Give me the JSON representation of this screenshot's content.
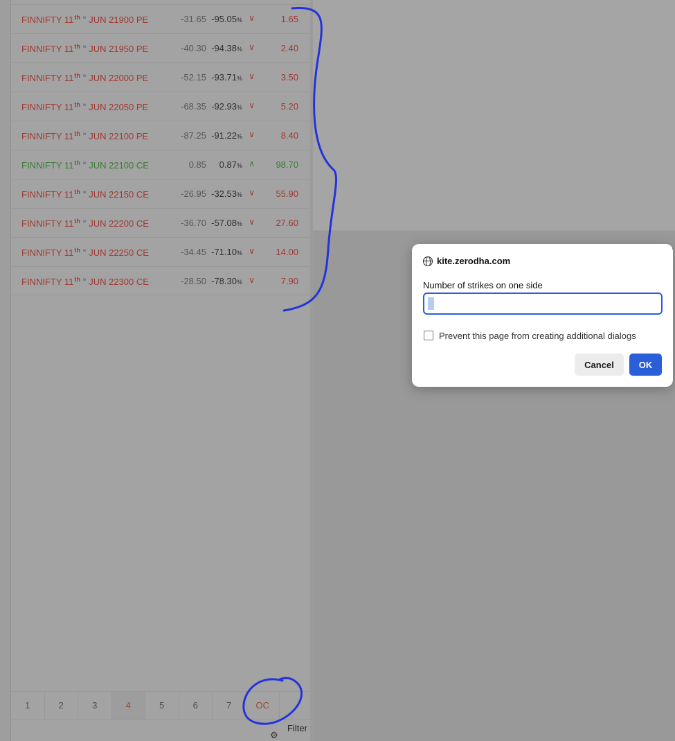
{
  "marketwatch": {
    "rows": [
      {
        "name": "FINNIFTY 11",
        "suffix": "th",
        "week": "w",
        "rest": "JUN 21900 PE",
        "change": "-31.65",
        "percent": "-95.05",
        "pct_unit": "%",
        "ltp": "1.65",
        "dir": "down"
      },
      {
        "name": "FINNIFTY 11",
        "suffix": "th",
        "week": "w",
        "rest": "JUN 21950 PE",
        "change": "-40.30",
        "percent": "-94.38",
        "pct_unit": "%",
        "ltp": "2.40",
        "dir": "down"
      },
      {
        "name": "FINNIFTY 11",
        "suffix": "th",
        "week": "w",
        "rest": "JUN 22000 PE",
        "change": "-52.15",
        "percent": "-93.71",
        "pct_unit": "%",
        "ltp": "3.50",
        "dir": "down"
      },
      {
        "name": "FINNIFTY 11",
        "suffix": "th",
        "week": "w",
        "rest": "JUN 22050 PE",
        "change": "-68.35",
        "percent": "-92.93",
        "pct_unit": "%",
        "ltp": "5.20",
        "dir": "down"
      },
      {
        "name": "FINNIFTY 11",
        "suffix": "th",
        "week": "w",
        "rest": "JUN 22100 PE",
        "change": "-87.25",
        "percent": "-91.22",
        "pct_unit": "%",
        "ltp": "8.40",
        "dir": "down"
      },
      {
        "name": "FINNIFTY 11",
        "suffix": "th",
        "week": "w",
        "rest": "JUN 22100 CE",
        "change": "0.85",
        "percent": "0.87",
        "pct_unit": "%",
        "ltp": "98.70",
        "dir": "up"
      },
      {
        "name": "FINNIFTY 11",
        "suffix": "th",
        "week": "w",
        "rest": "JUN 22150 CE",
        "change": "-26.95",
        "percent": "-32.53",
        "pct_unit": "%",
        "ltp": "55.90",
        "dir": "down"
      },
      {
        "name": "FINNIFTY 11",
        "suffix": "th",
        "week": "w",
        "rest": "JUN 22200 CE",
        "change": "-36.70",
        "percent": "-57.08",
        "pct_unit": "%",
        "ltp": "27.60",
        "dir": "down"
      },
      {
        "name": "FINNIFTY 11",
        "suffix": "th",
        "week": "w",
        "rest": "JUN 22250 CE",
        "change": "-34.45",
        "percent": "-71.10",
        "pct_unit": "%",
        "ltp": "14.00",
        "dir": "down"
      },
      {
        "name": "FINNIFTY 11",
        "suffix": "th",
        "week": "w",
        "rest": "JUN 22300 CE",
        "change": "-28.50",
        "percent": "-78.30",
        "pct_unit": "%",
        "ltp": "7.90",
        "dir": "down"
      }
    ],
    "arrows": {
      "down": "∨",
      "up": "∧"
    },
    "pages": [
      "1",
      "2",
      "3",
      "4",
      "5",
      "6",
      "7",
      "OC"
    ],
    "active_page": "4",
    "filter_label": "Filter"
  },
  "dialog": {
    "origin": "kite.zerodha.com",
    "label": "Number of strikes on one side",
    "input_value": "4",
    "checkbox_label": "Prevent this page from creating additional dialogs",
    "checkbox_checked": false,
    "cancel_label": "Cancel",
    "ok_label": "OK"
  },
  "icons": {
    "origin": "globe-icon",
    "filter": "gear-icon",
    "row_direction": "chevron-icon"
  },
  "colors": {
    "negative": "#a03a33",
    "positive": "#3a7d35",
    "accent": "#2b5fd9",
    "annotation": "#2233dd"
  }
}
